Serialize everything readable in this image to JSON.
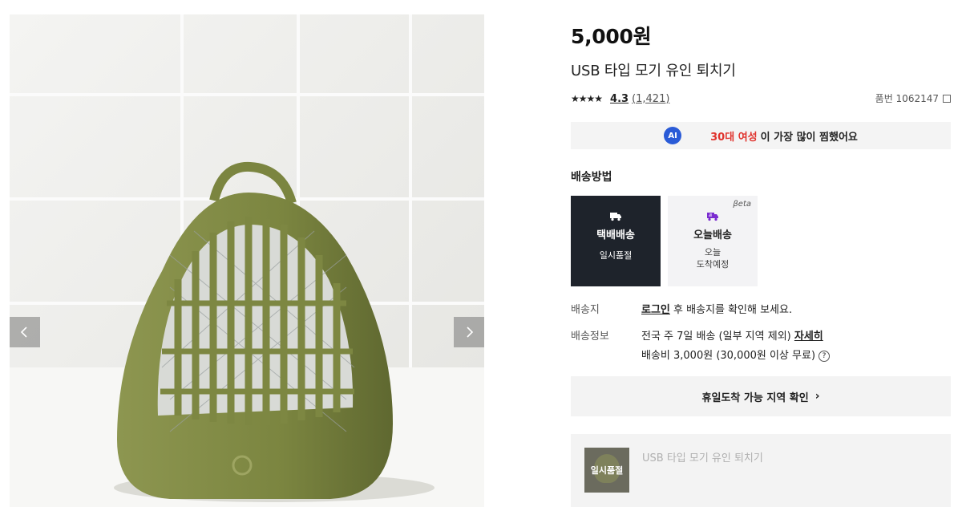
{
  "gallery": {
    "prev_icon": "chevron-left-icon",
    "next_icon": "chevron-right-icon"
  },
  "product": {
    "price": "5,000원",
    "title": "USB 타입 모기 유인 퇴치기",
    "stars": "★★★★",
    "rating": "4.3",
    "review_count": "(1,421)",
    "sku_label": "품번 1062147"
  },
  "ai_banner": {
    "badge": "AI",
    "highlight": "30대 여성",
    "rest": "이 가장 많이 찜했어요"
  },
  "shipping": {
    "heading": "배송방법",
    "options": [
      {
        "name": "택배배송",
        "sub": "일시품절",
        "icon": "truck-icon",
        "selected": true
      },
      {
        "name": "오늘배송",
        "sub_line1": "오늘",
        "sub_line2": "도착예정",
        "badge": "βeta",
        "icon": "fast-truck-icon",
        "selected": false
      }
    ],
    "destination_label": "배송지",
    "login_link": "로그인",
    "destination_text": " 후 배송지를 확인해 보세요.",
    "info_label": "배송정보",
    "info_text": "전국 주 7일 배송 (일부 지역 제외) ",
    "detail_link": "자세히",
    "fee_text": "배송비 3,000원 (30,000원 이상 무료)",
    "help_icon": "?"
  },
  "holiday_button": {
    "label": "휴일도착 가능 지역 확인",
    "chevron": "›"
  },
  "bottom_card": {
    "thumb_label": "일시품절",
    "title": "USB 타입 모기 유인 퇴치기"
  },
  "colors": {
    "accent_red": "#e0342e",
    "ai_blue": "#2a5bd7",
    "dark_card": "#1e232b",
    "product_green": "#7f8a3f"
  }
}
